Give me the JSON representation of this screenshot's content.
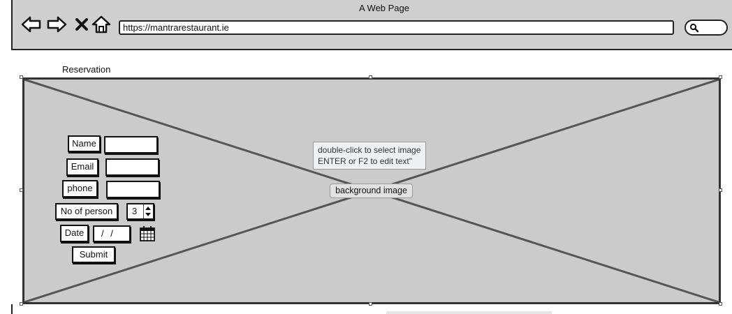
{
  "window": {
    "title": "A Web Page"
  },
  "toolbar": {
    "url": "https://mantrarestaurant.ie",
    "icons": [
      "back-arrow-icon",
      "forward-arrow-icon",
      "close-icon",
      "home-icon",
      "search-icon"
    ]
  },
  "page": {
    "title": "Reservation"
  },
  "placeholder": {
    "hint_line1": "double-click to select image",
    "hint_line2": "ENTER or F2 to edit text\"",
    "label": "background image"
  },
  "form": {
    "name_label": "Name",
    "email_label": "Email",
    "phone_label": "phone",
    "persons_label": "No of person",
    "persons_value": "3",
    "date_label": "Date",
    "date_value": "/ /",
    "submit_label": "Submit"
  },
  "colors": {
    "chrome": "#cfcfcf",
    "placeholder": "#cbcbcb",
    "stroke": "#333333"
  }
}
